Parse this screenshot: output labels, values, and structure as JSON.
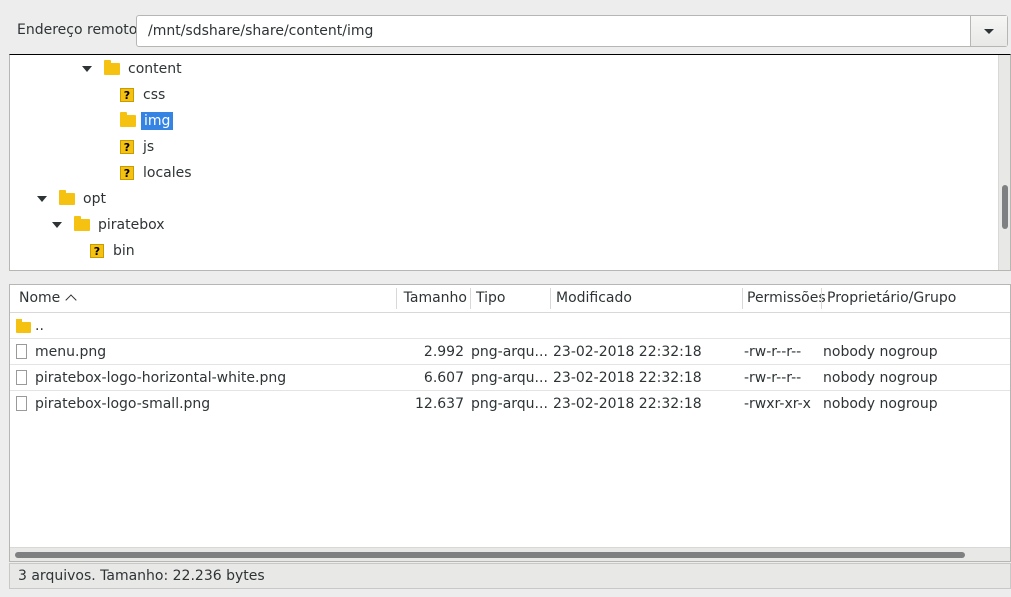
{
  "address_bar": {
    "label": "Endereço remoto:",
    "value": "/mnt/sdshare/share/content/img"
  },
  "tree": {
    "items": [
      {
        "label": "content",
        "icon": "folder-icon",
        "expanded": true
      },
      {
        "label": "css",
        "icon": "unknown-folder-icon"
      },
      {
        "label": "img",
        "icon": "folder-icon",
        "selected": true
      },
      {
        "label": "js",
        "icon": "unknown-folder-icon"
      },
      {
        "label": "locales",
        "icon": "unknown-folder-icon"
      },
      {
        "label": "opt",
        "icon": "folder-icon",
        "expanded": true
      },
      {
        "label": "piratebox",
        "icon": "folder-icon",
        "expanded": true
      },
      {
        "label": "bin",
        "icon": "unknown-folder-icon"
      }
    ]
  },
  "file_list": {
    "columns": [
      "Nome",
      "Tamanho",
      "Tipo",
      "Modificado",
      "Permissões",
      "Proprietário/Grupo"
    ],
    "parent_label": "..",
    "rows": [
      {
        "name": "menu.png",
        "size": "2.992",
        "type": "png-arqu...",
        "modified": "23-02-2018 22:32:18",
        "perms": "-rw-r--r--",
        "owner": "nobody nogroup"
      },
      {
        "name": "piratebox-logo-horizontal-white.png",
        "size": "6.607",
        "type": "png-arqu...",
        "modified": "23-02-2018 22:32:18",
        "perms": "-rw-r--r--",
        "owner": "nobody nogroup"
      },
      {
        "name": "piratebox-logo-small.png",
        "size": "12.637",
        "type": "png-arqu...",
        "modified": "23-02-2018 22:32:18",
        "perms": "-rwxr-xr-x",
        "owner": "nobody nogroup"
      }
    ]
  },
  "status": {
    "text": "3 arquivos. Tamanho: 22.236 bytes"
  },
  "colors": {
    "selection": "#3584e4",
    "folder": "#f5c211"
  }
}
